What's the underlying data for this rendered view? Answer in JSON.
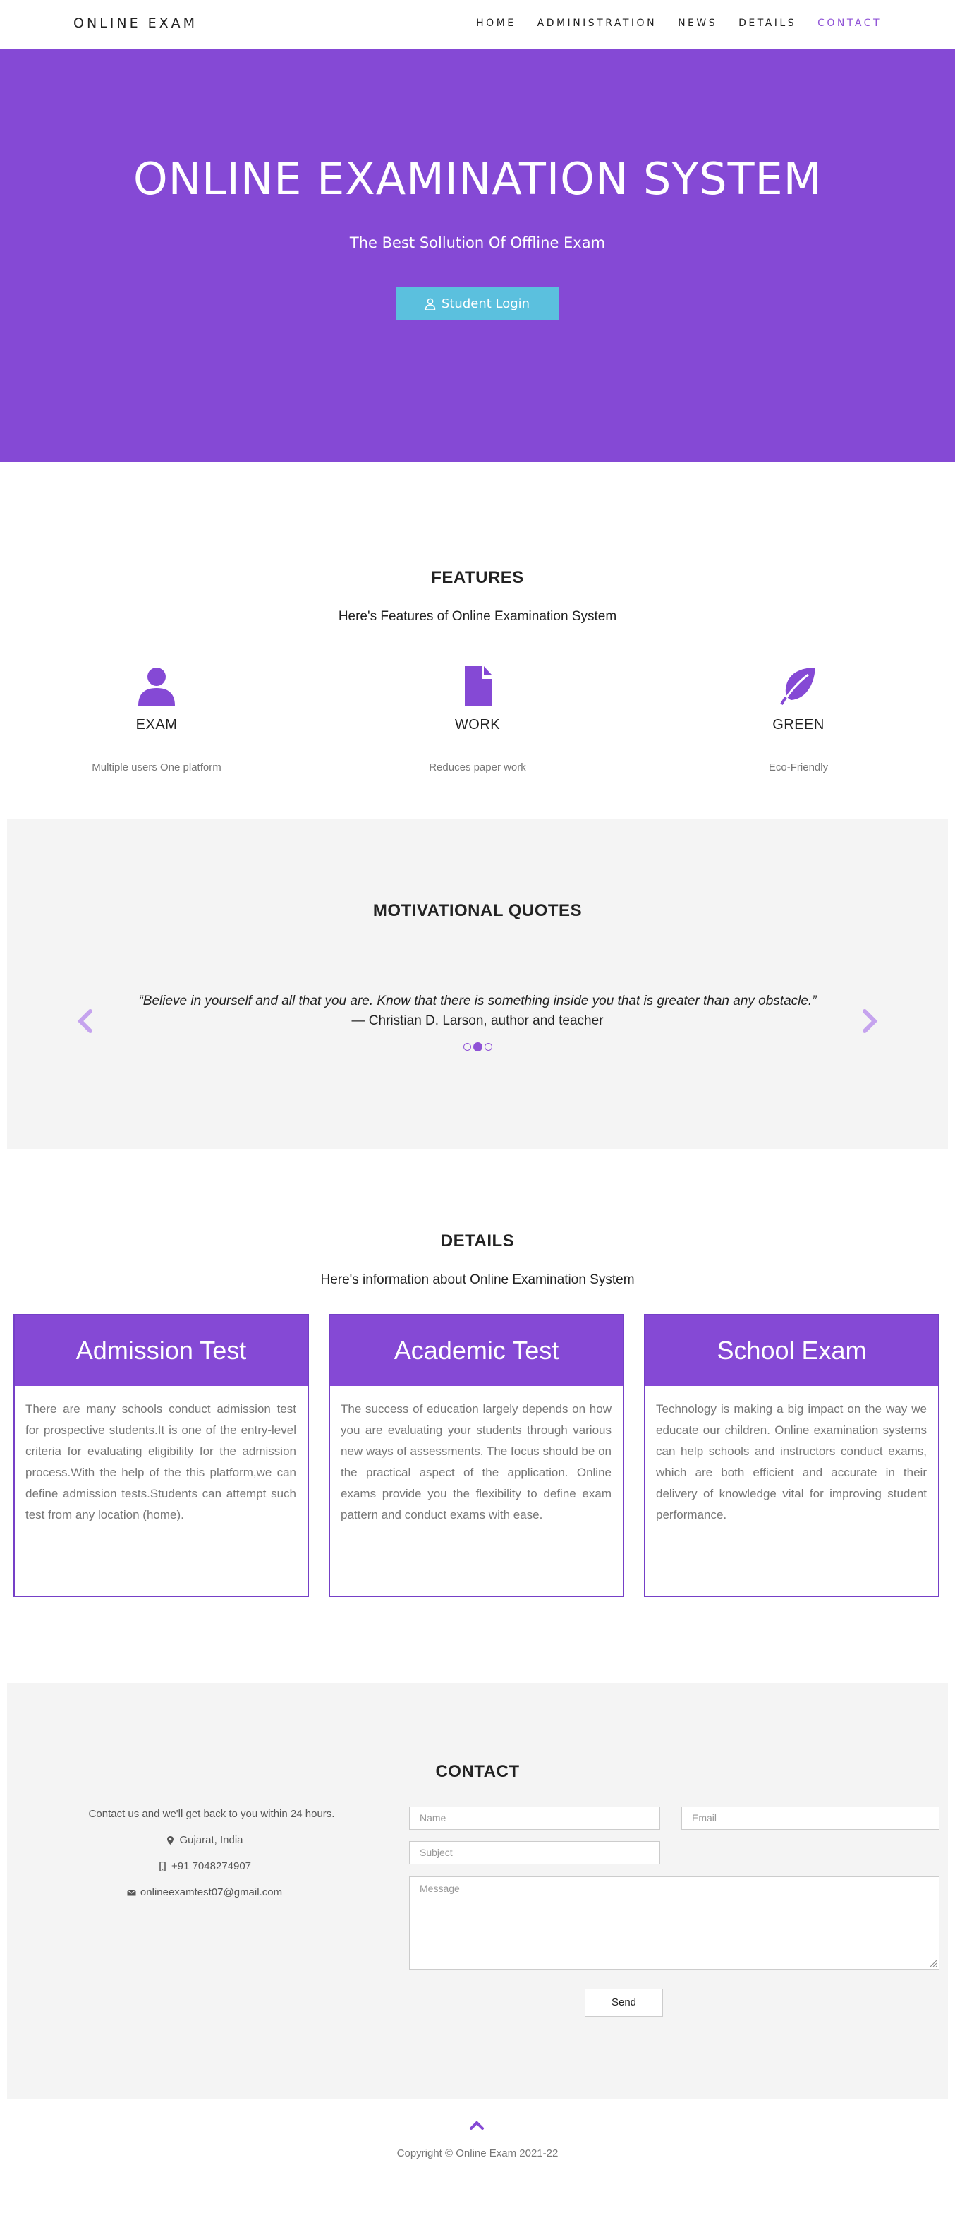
{
  "nav": {
    "brand": "ONLINE EXAM",
    "links": [
      "HOME",
      "ADMINISTRATION",
      "NEWS",
      "DETAILS",
      "CONTACT"
    ],
    "active": "CONTACT"
  },
  "hero": {
    "title": "ONLINE EXAMINATION SYSTEM",
    "subtitle": "The Best Sollution Of Offline Exam",
    "button_label": "Student Login",
    "button_icon": "user-icon",
    "bg_color": "#8549d5",
    "button_color": "#5bc0de"
  },
  "features": {
    "title": "FEATURES",
    "subtitle": "Here's Features of Online Examination System",
    "items": [
      {
        "icon": "user-icon",
        "name": "EXAM",
        "desc": "Multiple users One platform"
      },
      {
        "icon": "file-icon",
        "name": "WORK",
        "desc": "Reduces paper work"
      },
      {
        "icon": "leaf-icon",
        "name": "GREEN",
        "desc": "Eco-Friendly"
      }
    ]
  },
  "quotes": {
    "title": "MOTIVATIONAL QUOTES",
    "text": "“Believe in yourself and all that you are. Know that there is something inside you that is greater than any obstacle.”",
    "author": "— Christian D. Larson, author and teacher",
    "slide_count": 3,
    "active_slide": 2
  },
  "details": {
    "title": "DETAILS",
    "subtitle": "Here's information about Online Examination System",
    "cards": [
      {
        "title": "Admission Test",
        "text": "There are many schools conduct admission test for prospective students.It is one of the entry-level criteria for evaluating eligibility for the admission process.With the help of the this platform,we can define admission tests.Students can attempt such test from any location (home)."
      },
      {
        "title": "Academic Test",
        "text": "The success of education largely depends on how you are evaluating your students through various new ways of assessments. The focus should be on the practical aspect of the application. Online exams provide you the flexibility to define exam pattern and conduct exams with ease."
      },
      {
        "title": "School Exam",
        "text": "Technology is making a big impact on the way we educate our children. Online examination systems can help schools and instructors conduct exams, which are both efficient and accurate in their delivery of knowledge vital for improving student performance."
      }
    ]
  },
  "contact": {
    "title": "CONTACT",
    "intro": "Contact us and we'll get back to you within 24 hours.",
    "location": "Gujarat, India",
    "phone": "+91 7048274907",
    "email": "onlineexamtest07@gmail.com",
    "form": {
      "name_placeholder": "Name",
      "email_placeholder": "Email",
      "subject_placeholder": "Subject",
      "message_placeholder": "Message",
      "send_label": "Send"
    }
  },
  "footer": {
    "copyright": "Copyright © Online Exam  2021-22"
  }
}
